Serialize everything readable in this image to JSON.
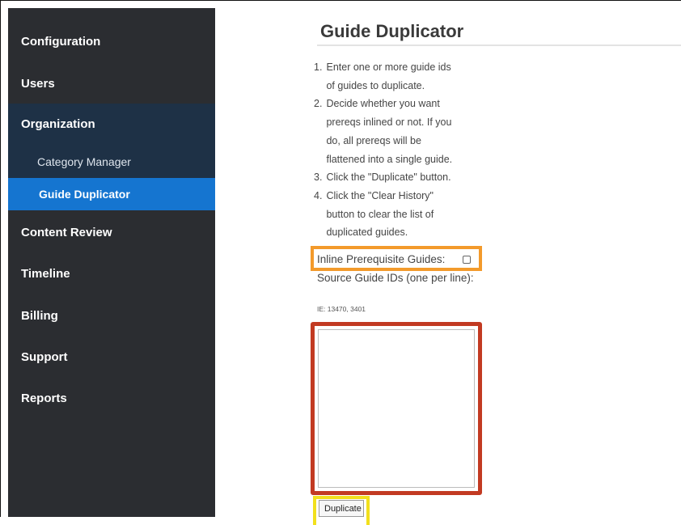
{
  "sidebar": {
    "items": [
      {
        "label": "Configuration"
      },
      {
        "label": "Users"
      },
      {
        "label": "Organization"
      },
      {
        "label": "Content Review"
      },
      {
        "label": "Timeline"
      },
      {
        "label": "Billing"
      },
      {
        "label": "Support"
      },
      {
        "label": "Reports"
      }
    ],
    "subitems": [
      {
        "label": "Category Manager"
      },
      {
        "label": "Guide Duplicator",
        "active": true
      }
    ]
  },
  "main": {
    "title": "Guide Duplicator",
    "steps": [
      {
        "num": "1.",
        "lines": [
          "Enter one or more guide ids",
          "of guides to duplicate."
        ]
      },
      {
        "num": "2.",
        "lines": [
          "Decide whether you want",
          "prereqs inlined or not. If you",
          "do, all prereqs will be",
          "flattened into a single guide."
        ]
      },
      {
        "num": "3.",
        "lines": [
          "Click the \"Duplicate\" button."
        ]
      },
      {
        "num": "4.",
        "lines": [
          "Click the \"Clear History\"",
          "button to clear the list of",
          "duplicated guides."
        ]
      }
    ],
    "inline_label": "Inline Prerequisite Guides:",
    "inline_checked": false,
    "source_label": "Source Guide IDs (one per line):",
    "example": "IE: 13470, 3401",
    "textarea_value": "",
    "duplicate_label": "Duplicate"
  },
  "colors": {
    "sidebar_bg": "#2b2d31",
    "group_bg": "#1e3146",
    "active_bg": "#1575d0",
    "highlight_orange": "#f39a2b",
    "highlight_red": "#c23a22",
    "highlight_yellow": "#f2e01d"
  }
}
